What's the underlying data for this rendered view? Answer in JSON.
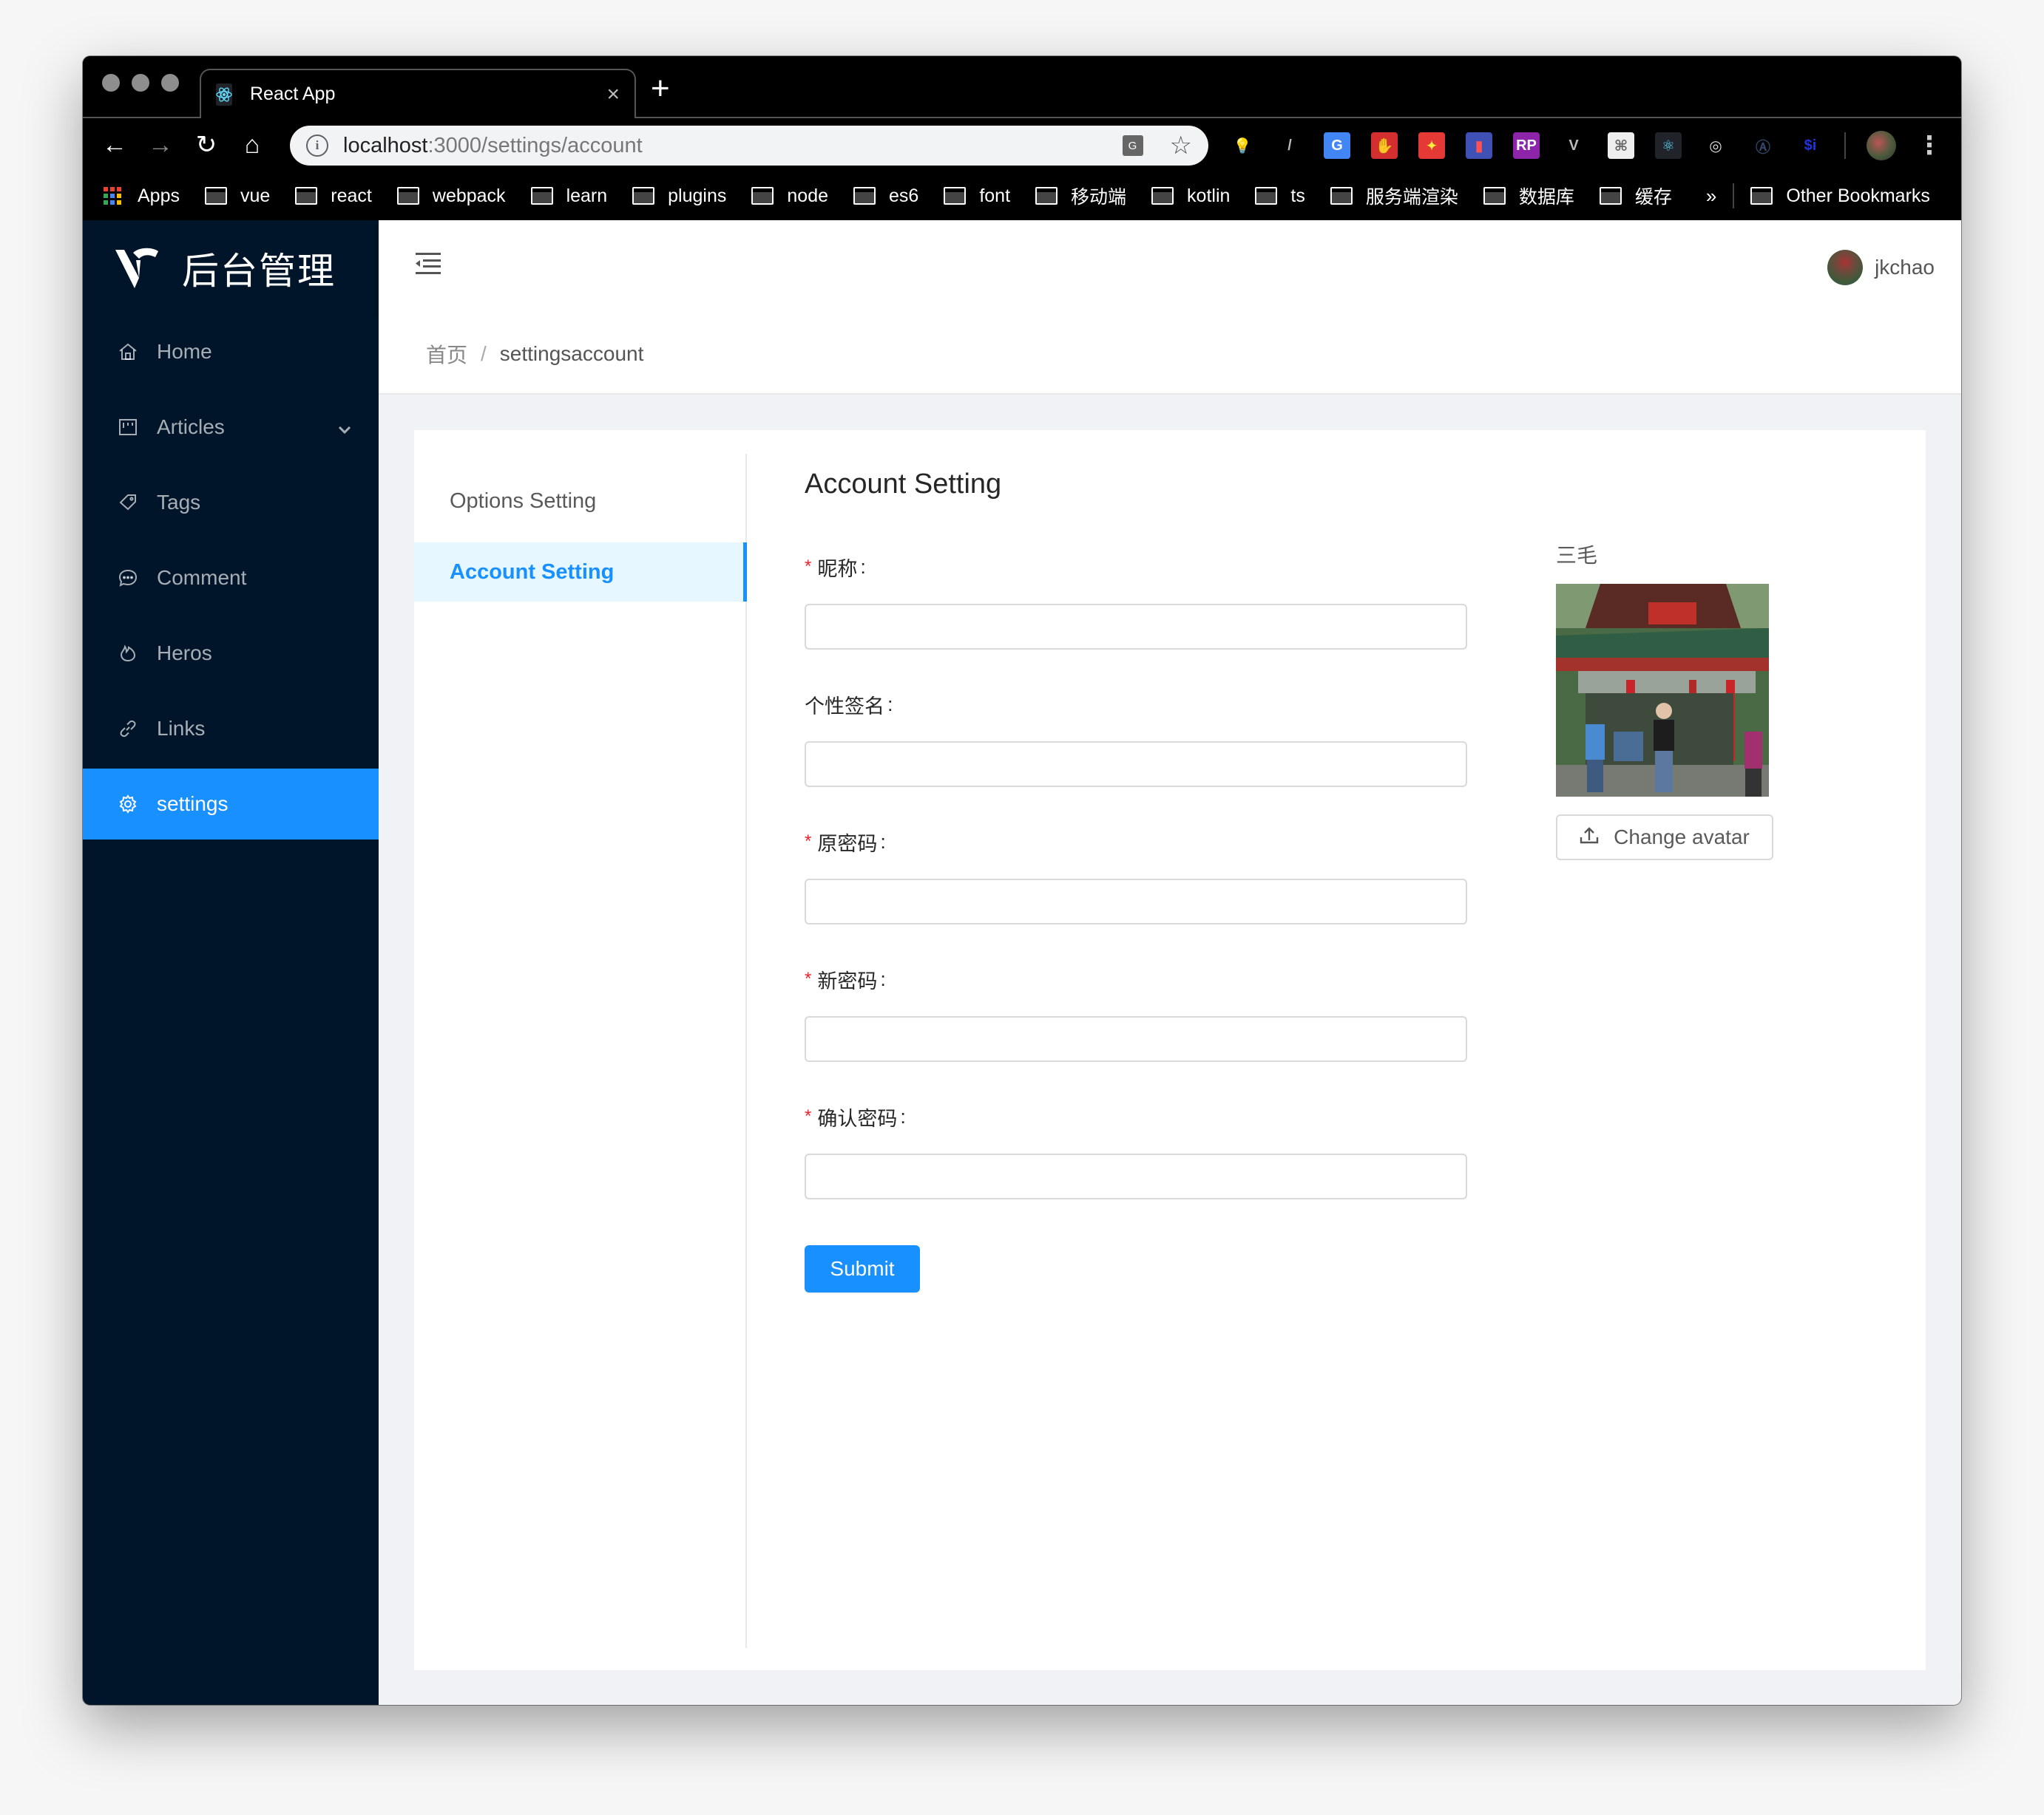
{
  "browser": {
    "tab_title": "React App",
    "tab_close": "×",
    "new_tab": "+",
    "url_host": "localhost",
    "url_rest": ":3000/settings/account",
    "nav": {
      "back": "←",
      "forward": "→",
      "reload": "↻",
      "home": "⌂"
    },
    "star": "☆",
    "translate_badge": "G",
    "extensions": [
      {
        "name": "lightbulb-extension",
        "glyph": "💡",
        "bg": "#000000",
        "color": "#bbbbbb"
      },
      {
        "name": "pen-extension",
        "glyph": "/",
        "bg": "#000000",
        "color": "#bbbbbb"
      },
      {
        "name": "google-translate-extension",
        "glyph": "G",
        "bg": "#4285f4",
        "color": "#ffffff"
      },
      {
        "name": "adblock-extension",
        "glyph": "✋",
        "bg": "#d32f2f",
        "color": "#ffffff"
      },
      {
        "name": "magic-extension",
        "glyph": "✦",
        "bg": "#e53935",
        "color": "#ffeb3b"
      },
      {
        "name": "lighthouse-extension",
        "glyph": "▮",
        "bg": "#3f51b5",
        "color": "#ff5252"
      },
      {
        "name": "rp-extension",
        "glyph": "RP",
        "bg": "#8e24aa",
        "color": "#ffffff"
      },
      {
        "name": "vue-devtools-extension",
        "glyph": "V",
        "bg": "#000000",
        "color": "#bbbbbb"
      },
      {
        "name": "sitemap-extension",
        "glyph": "⌘",
        "bg": "#eeeeee",
        "color": "#666666"
      },
      {
        "name": "react-devtools-extension",
        "glyph": "⚛",
        "bg": "#20232a",
        "color": "#61dafb"
      },
      {
        "name": "target-extension",
        "glyph": "◎",
        "bg": "#000000",
        "color": "#dddddd"
      },
      {
        "name": "a-extension",
        "glyph": "Ⓐ",
        "bg": "#000000",
        "color": "#334466"
      },
      {
        "name": "si-extension",
        "glyph": "$i",
        "bg": "#000000",
        "color": "#2233dd"
      }
    ],
    "menu": "⋮",
    "bookmarks": {
      "apps_label": "Apps",
      "folders": [
        "vue",
        "react",
        "webpack",
        "learn",
        "plugins",
        "node",
        "es6",
        "font",
        "移动端",
        "kotlin",
        "ts",
        "服务端渲染",
        "数据库",
        "缓存"
      ],
      "more": "»",
      "other": "Other Bookmarks"
    }
  },
  "app": {
    "logo_text": "后台管理",
    "sidebar": [
      {
        "label": "Home",
        "icon": "home-icon"
      },
      {
        "label": "Articles",
        "icon": "articles-icon",
        "has_submenu": true
      },
      {
        "label": "Tags",
        "icon": "tag-icon"
      },
      {
        "label": "Comment",
        "icon": "comment-icon"
      },
      {
        "label": "Heros",
        "icon": "fire-icon"
      },
      {
        "label": "Links",
        "icon": "link-icon"
      },
      {
        "label": "settings",
        "icon": "gear-icon",
        "active": true
      }
    ],
    "user": {
      "name": "jkchao"
    },
    "breadcrumb": {
      "home": "首页",
      "separator": "/",
      "current": "settingsaccount"
    },
    "settings_menu": [
      {
        "label": "Options Setting",
        "active": false
      },
      {
        "label": "Account Setting",
        "active": true
      }
    ],
    "form": {
      "title": "Account Setting",
      "fields": [
        {
          "label": "昵称",
          "required": true,
          "value": "",
          "type": "text"
        },
        {
          "label": "个性签名",
          "required": false,
          "value": "",
          "type": "text"
        },
        {
          "label": "原密码",
          "required": true,
          "value": "",
          "type": "password"
        },
        {
          "label": "新密码",
          "required": true,
          "value": "",
          "type": "password"
        },
        {
          "label": "确认密码",
          "required": true,
          "value": "",
          "type": "password"
        }
      ],
      "label_suffix": ":",
      "required_mark": "*",
      "submit": "Submit"
    },
    "avatar": {
      "display_name": "三毛",
      "change_label": "Change avatar"
    },
    "colors": {
      "primary": "#1890ff",
      "sidebar_bg": "#001529",
      "required": "#f5222d"
    }
  }
}
